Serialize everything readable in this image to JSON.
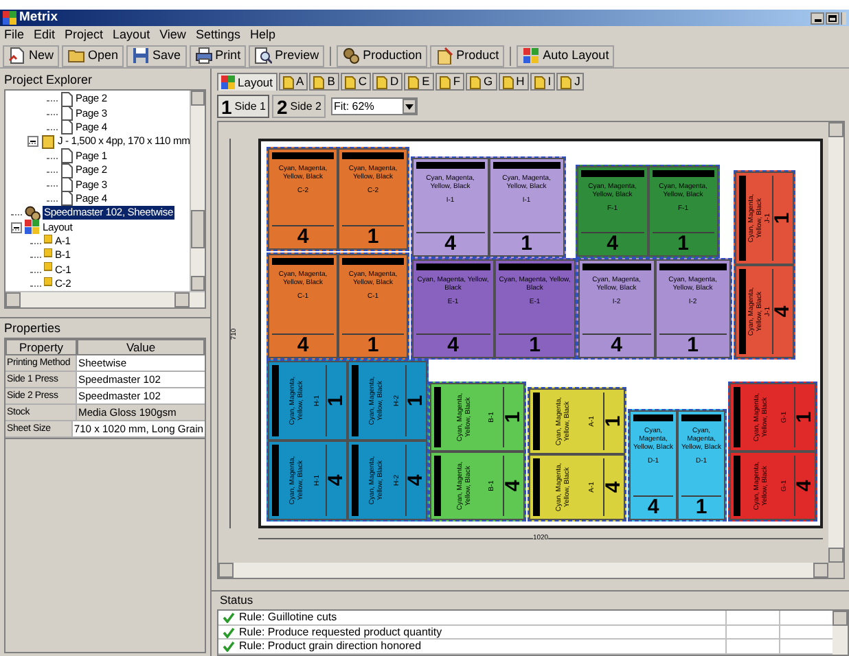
{
  "window": {
    "title": "Metrix"
  },
  "menu": [
    "File",
    "Edit",
    "Project",
    "Layout",
    "View",
    "Settings",
    "Help"
  ],
  "toolbar": [
    {
      "kind": "new",
      "label": "New"
    },
    {
      "kind": "open",
      "label": "Open"
    },
    {
      "kind": "save",
      "label": "Save"
    },
    {
      "kind": "print",
      "label": "Print"
    },
    {
      "kind": "preview",
      "label": "Preview"
    },
    {
      "kind": "production",
      "label": "Production"
    },
    {
      "kind": "product",
      "label": "Product"
    },
    {
      "kind": "auto",
      "label": "Auto Layout"
    }
  ],
  "explorer": {
    "title": "Project Explorer",
    "tree": [
      {
        "kind": "page",
        "label": "Page 2",
        "selected": false
      },
      {
        "kind": "page",
        "label": "Page 3",
        "selected": false
      },
      {
        "kind": "page",
        "label": "Page 4",
        "selected": false
      },
      {
        "kind": "product",
        "label": "J - 1,500 x 4pp, 170 x 110 mm",
        "selected": false,
        "expanded": true,
        "children": [
          {
            "kind": "page",
            "label": "Page 1",
            "selected": false
          },
          {
            "kind": "page",
            "label": "Page 2",
            "selected": false
          },
          {
            "kind": "page",
            "label": "Page 3",
            "selected": false
          },
          {
            "kind": "page",
            "label": "Page 4",
            "selected": false
          }
        ]
      },
      {
        "kind": "press",
        "label": "Speedmaster 102, Sheetwise",
        "selected": true
      },
      {
        "kind": "layout",
        "label": "Layout",
        "selected": false,
        "expanded": true,
        "children": [
          {
            "kind": "part",
            "label": "A-1",
            "selected": false
          },
          {
            "kind": "part",
            "label": "B-1",
            "selected": false
          },
          {
            "kind": "part",
            "label": "C-1",
            "selected": false
          },
          {
            "kind": "part",
            "label": "C-2",
            "selected": false
          }
        ]
      }
    ]
  },
  "properties": {
    "title": "Properties",
    "columns": [
      "Property",
      "Value"
    ],
    "rows": [
      {
        "property": "Printing Method",
        "value": "Sheetwise",
        "editable": true
      },
      {
        "property": "Side 1 Press",
        "value": "Speedmaster 102",
        "editable": true
      },
      {
        "property": "Side 2 Press",
        "value": "Speedmaster 102",
        "editable": true
      },
      {
        "property": "Stock",
        "value": "Media Gloss 190gsm",
        "editable": false
      },
      {
        "property": "Sheet Size",
        "value": "710 x 1020 mm, Long Grain",
        "editable": true
      }
    ]
  },
  "tabs": [
    {
      "kind": "layout",
      "label": "Layout",
      "selected": true
    },
    {
      "kind": "part",
      "label": "A",
      "selected": false
    },
    {
      "kind": "part",
      "label": "B",
      "selected": false
    },
    {
      "kind": "part",
      "label": "C",
      "selected": false
    },
    {
      "kind": "part",
      "label": "D",
      "selected": false
    },
    {
      "kind": "part",
      "label": "E",
      "selected": false
    },
    {
      "kind": "part",
      "label": "F",
      "selected": false
    },
    {
      "kind": "part",
      "label": "G",
      "selected": false
    },
    {
      "kind": "part",
      "label": "H",
      "selected": false
    },
    {
      "kind": "part",
      "label": "I",
      "selected": false
    },
    {
      "kind": "part",
      "label": "J",
      "selected": false
    }
  ],
  "sides": [
    {
      "number": "1",
      "label": "Side 1",
      "selected": true
    },
    {
      "number": "2",
      "label": "Side 2",
      "selected": false
    }
  ],
  "zoom": {
    "value": "Fit: 62%"
  },
  "sheet": {
    "height_label": "710",
    "width_label": "1020",
    "groups": [
      {
        "color": "#e0742e",
        "pages": [
          {
            "kind": "upright",
            "inks": "Cyan, Magenta, Yellow, Black",
            "label": "C-2",
            "number": "4"
          },
          {
            "kind": "upright",
            "inks": "Cyan, Magenta, Yellow, Black",
            "label": "C-2",
            "number": "1"
          }
        ]
      },
      {
        "color": "#e0742e",
        "pages": [
          {
            "kind": "upright",
            "inks": "Cyan, Magenta, Yellow, Black",
            "label": "C-1",
            "number": "4"
          },
          {
            "kind": "upright",
            "inks": "Cyan, Magenta, Yellow, Black",
            "label": "C-1",
            "number": "1"
          }
        ]
      },
      {
        "color": "#b09ad8",
        "pages": [
          {
            "kind": "upright",
            "inks": "Cyan, Magenta, Yellow, Black",
            "label": "I-1",
            "number": "4"
          },
          {
            "kind": "upright",
            "inks": "Cyan, Magenta, Yellow, Black",
            "label": "I-1",
            "number": "1"
          }
        ]
      },
      {
        "color": "#8862be",
        "pages": [
          {
            "kind": "upright",
            "inks": "Cyan, Magenta, Yellow, Black",
            "label": "E-1",
            "number": "4"
          },
          {
            "kind": "upright",
            "inks": "Cyan, Magenta, Yellow, Black",
            "label": "E-1",
            "number": "1"
          }
        ]
      },
      {
        "color": "#2e8c3a",
        "pages": [
          {
            "kind": "upright",
            "inks": "Cyan, Magenta, Yellow, Black",
            "label": "F-1",
            "number": "4"
          },
          {
            "kind": "upright",
            "inks": "Cyan, Magenta, Yellow, Black",
            "label": "F-1",
            "number": "1"
          }
        ]
      },
      {
        "color": "#a890d2",
        "pages": [
          {
            "kind": "upright",
            "inks": "Cyan, Magenta, Yellow, Black",
            "label": "I-2",
            "number": "4"
          },
          {
            "kind": "upright",
            "inks": "Cyan, Magenta, Yellow, Black",
            "label": "I-2",
            "number": "1"
          }
        ]
      },
      {
        "color": "#e2523a",
        "pages": [
          {
            "kind": "rotated",
            "inks": "Cyan, Magenta, Yellow, Black",
            "label": "J-1",
            "number": "1"
          },
          {
            "kind": "rotated",
            "inks": "Cyan, Magenta, Yellow, Black",
            "label": "J-1",
            "number": "4"
          }
        ]
      },
      {
        "color": "#1690c2",
        "pages": [
          {
            "kind": "rotated",
            "inks": "Cyan, Magenta, Yellow, Black",
            "label": "H-1",
            "number": "1"
          },
          {
            "kind": "rotated",
            "inks": "Cyan, Magenta, Yellow, Black",
            "label": "H-2",
            "number": "1"
          },
          {
            "kind": "rotated",
            "inks": "Cyan, Magenta, Yellow, Black",
            "label": "H-1",
            "number": "4"
          },
          {
            "kind": "rotated",
            "inks": "Cyan, Magenta, Yellow, Black",
            "label": "H-2",
            "number": "4"
          }
        ]
      },
      {
        "color": "#5ec852",
        "pages": [
          {
            "kind": "rotated",
            "inks": "Cyan, Magenta, Yellow, Black",
            "label": "B-1",
            "number": "1"
          },
          {
            "kind": "rotated",
            "inks": "Cyan, Magenta, Yellow, Black",
            "label": "B-1",
            "number": "4"
          }
        ]
      },
      {
        "color": "#dad23c",
        "pages": [
          {
            "kind": "rotated",
            "inks": "Cyan, Magenta, Yellow, Black",
            "label": "A-1",
            "number": "1"
          },
          {
            "kind": "rotated",
            "inks": "Cyan, Magenta, Yellow, Black",
            "label": "A-1",
            "number": "4"
          }
        ]
      },
      {
        "color": "#3cc2ea",
        "pages": [
          {
            "kind": "upright",
            "inks": "Cyan, Magenta, Yellow, Black",
            "label": "D-1",
            "number": "4"
          },
          {
            "kind": "upright",
            "inks": "Cyan, Magenta, Yellow, Black",
            "label": "D-1",
            "number": "1"
          }
        ]
      },
      {
        "color": "#e02a2a",
        "pages": [
          {
            "kind": "rotated",
            "inks": "Cyan, Magenta, Yellow, Black",
            "label": "G-1",
            "number": "1"
          },
          {
            "kind": "rotated",
            "inks": "Cyan, Magenta, Yellow, Black",
            "label": "G-1",
            "number": "4"
          }
        ]
      }
    ]
  },
  "status": {
    "title": "Status",
    "rows": [
      {
        "passed": true,
        "text": "Rule: Guillotine cuts"
      },
      {
        "passed": true,
        "text": "Rule: Produce requested product quantity"
      },
      {
        "passed": true,
        "text": "Rule: Product grain direction honored"
      }
    ]
  }
}
